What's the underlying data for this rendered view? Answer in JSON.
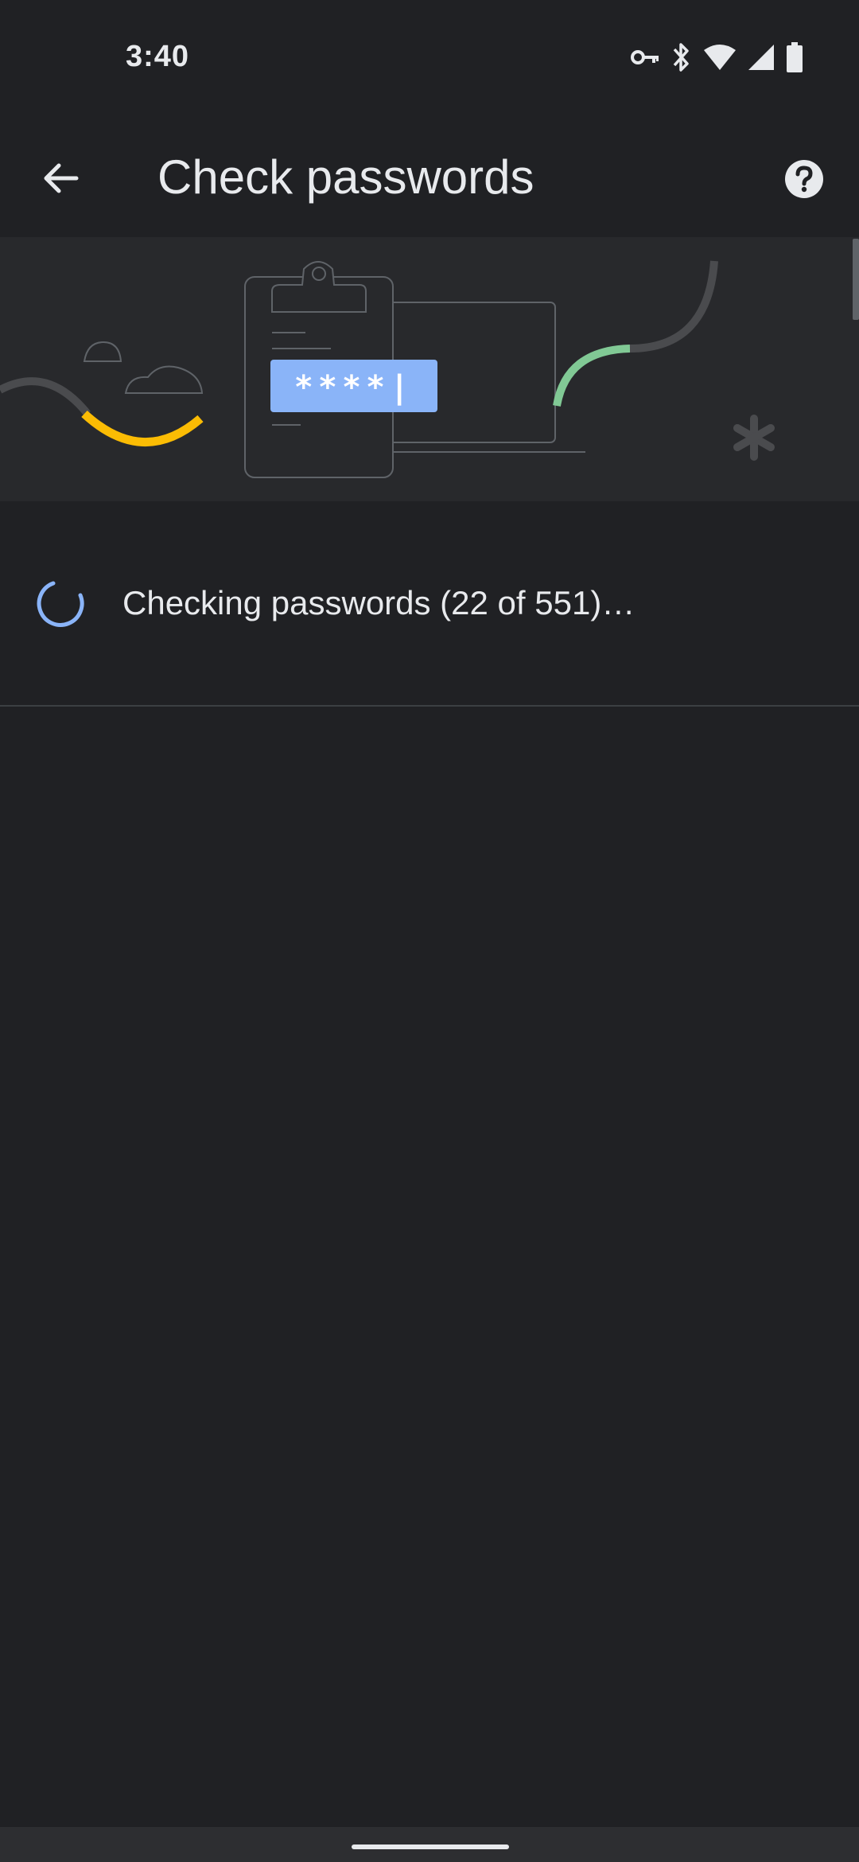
{
  "status_bar": {
    "time": "3:40",
    "icons": [
      "vpn-key-icon",
      "bluetooth-icon",
      "wifi-icon",
      "cell-signal-icon",
      "battery-icon"
    ]
  },
  "app_bar": {
    "title": "Check passwords",
    "back_icon": "arrow-back-icon",
    "help_icon": "help-icon"
  },
  "illustration": {
    "password_field_text": "****|",
    "colors": {
      "blue_field": "#8ab4f8",
      "yellow_curve": "#fbbc04",
      "green_curve": "#81c995",
      "line_gray": "#5f6368"
    }
  },
  "check_status": {
    "text": "Checking passwords (22 of 551)…",
    "spinner_color": "#8ab4f8"
  },
  "theme": {
    "background": "#202124",
    "banner_background": "#28292c",
    "text": "#e8eaed"
  }
}
